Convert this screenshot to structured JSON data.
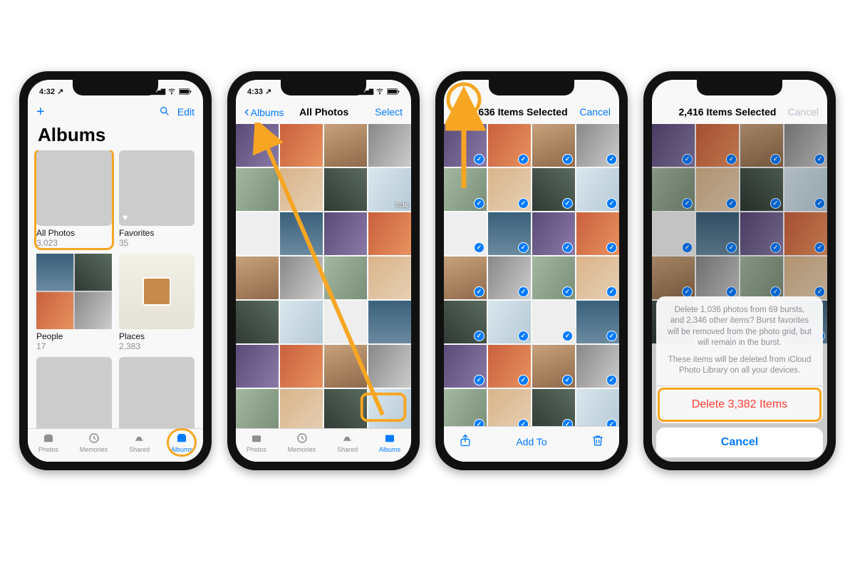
{
  "phone1": {
    "status": {
      "time": "4:32",
      "loc": "↗"
    },
    "nav": {
      "edit": "Edit"
    },
    "title": "Albums",
    "albums": [
      {
        "label": "All Photos",
        "count": "3,023"
      },
      {
        "label": "Favorites",
        "count": "35"
      },
      {
        "label": "People",
        "count": "17"
      },
      {
        "label": "Places",
        "count": "2,383"
      }
    ],
    "tabs": [
      "Photos",
      "Memories",
      "Shared",
      "Albums"
    ]
  },
  "phone2": {
    "status": {
      "time": "4:33",
      "loc": "↗"
    },
    "nav": {
      "back": "Albums",
      "title": "All Photos",
      "select": "Select"
    },
    "clip": "0:36"
  },
  "phone3": {
    "nav": {
      "title": "636 Items Selected",
      "cancel": "Cancel"
    },
    "toolbar": {
      "add": "Add To"
    }
  },
  "phone4": {
    "nav": {
      "title": "2,416 Items Selected",
      "cancel": "Cancel"
    },
    "sheet": {
      "msg1": "Delete 1,036 photos from 69 bursts, and 2,346 other items? Burst favorites will be removed from the photo grid, but will remain in the burst.",
      "msg2": "These items will be deleted from iCloud Photo Library on all your devices.",
      "delete": "Delete 3,382 Items",
      "cancel": "Cancel"
    }
  }
}
